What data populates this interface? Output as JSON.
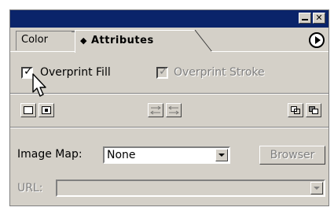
{
  "tabs": [
    {
      "label": "Color",
      "active": false
    },
    {
      "label": "Attributes",
      "active": true
    }
  ],
  "overprint_fill": {
    "label": "Overprint Fill",
    "checked": true
  },
  "overprint_stroke": {
    "label": "Overprint Stroke",
    "checked": true,
    "disabled": true
  },
  "image_map": {
    "label": "Image Map:",
    "value": "None"
  },
  "browser_button": {
    "label": "Browser"
  },
  "url": {
    "label": "URL:",
    "value": ""
  },
  "icons": {
    "titlebar": [
      "minimize-icon",
      "close-icon"
    ],
    "tab": [
      "sort-arrows-icon"
    ],
    "menu": "panel-menu-icon",
    "row": [
      "show-center-off-icon",
      "show-center-on-icon",
      "reverse-path-direction-off-icon",
      "reverse-path-direction-on-icon",
      "use-non-zero-winding-icon",
      "use-even-odd-icon"
    ]
  },
  "colors": {
    "titlebar": "#0a246a",
    "panel": "#d4d0c8",
    "disabled_text": "#808080"
  }
}
